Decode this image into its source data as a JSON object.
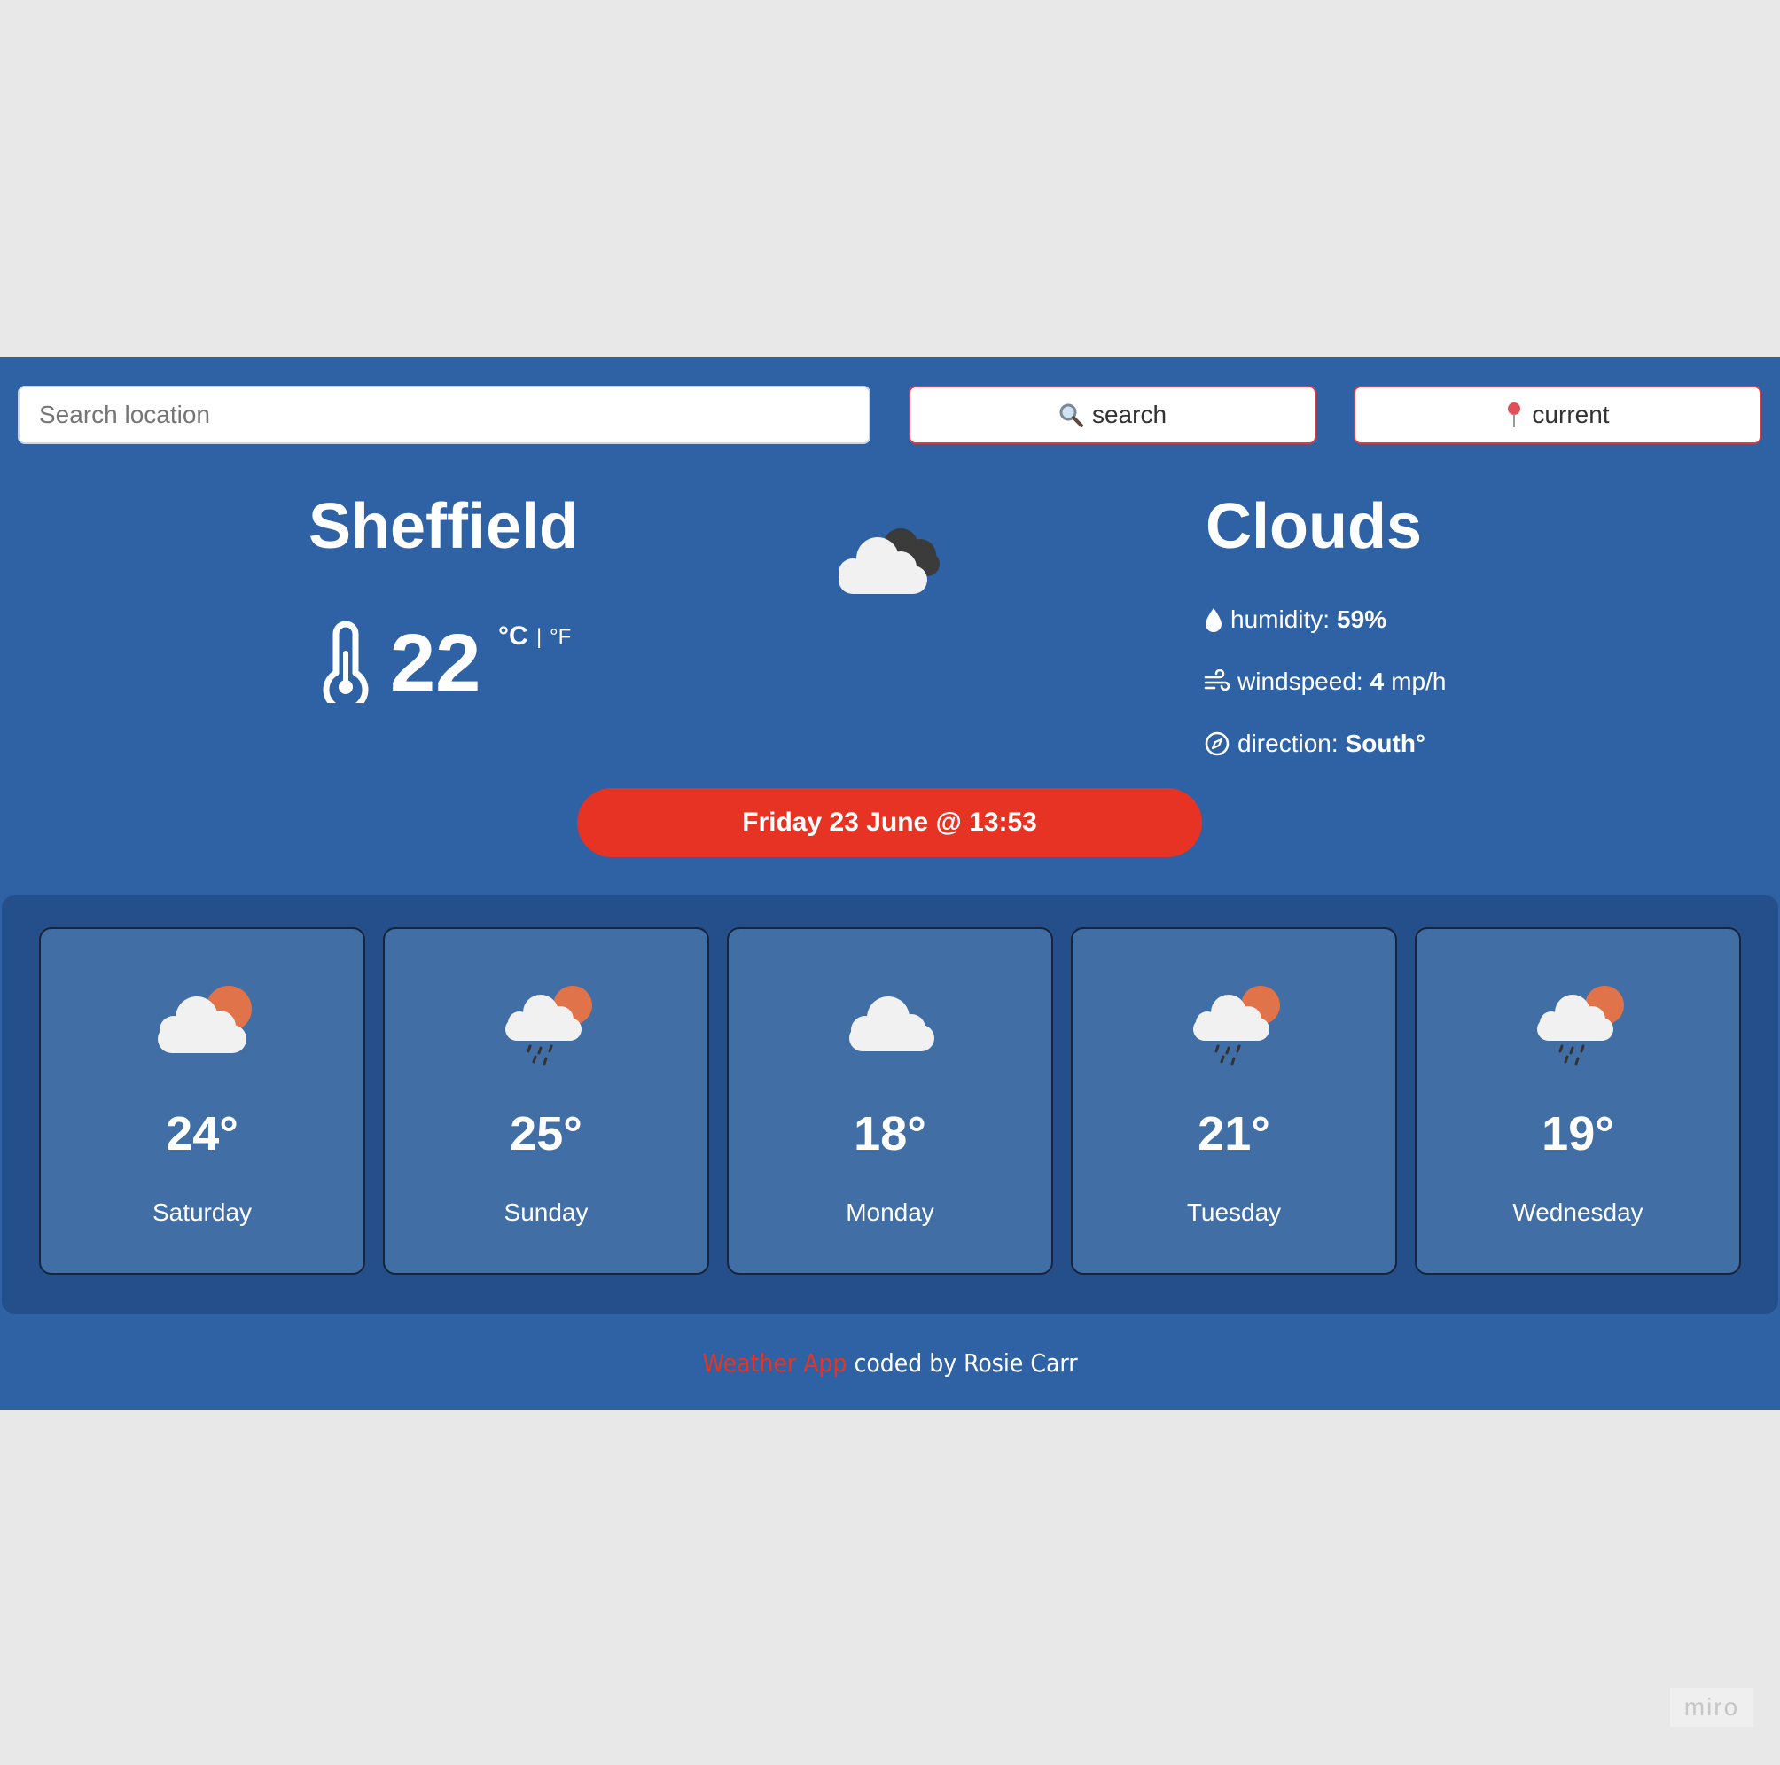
{
  "search": {
    "placeholder": "Search location",
    "value": "",
    "search_label": "search",
    "current_label": "current"
  },
  "current": {
    "city": "Sheffield",
    "temperature": "22",
    "unit_c": "°C",
    "unit_separator": "|",
    "unit_f": "°F",
    "condition": "Clouds",
    "icon": "broken-clouds-icon",
    "humidity_label": "humidity:",
    "humidity_value": "59%",
    "wind_label": "windspeed:",
    "wind_value": "4",
    "wind_unit": "mp/h",
    "direction_label": "direction:",
    "direction_value": "South°",
    "date": "Friday 23 June @ 13:53"
  },
  "forecast": [
    {
      "temp": "24°",
      "day": "Saturday",
      "icon": "partly-cloudy-icon"
    },
    {
      "temp": "25°",
      "day": "Sunday",
      "icon": "rain-sun-icon"
    },
    {
      "temp": "18°",
      "day": "Monday",
      "icon": "cloud-icon"
    },
    {
      "temp": "21°",
      "day": "Tuesday",
      "icon": "rain-sun-icon"
    },
    {
      "temp": "19°",
      "day": "Wednesday",
      "icon": "rain-sun-icon"
    }
  ],
  "footer": {
    "link": "Weather App",
    "text": " coded by Rosie Carr"
  },
  "watermark": "miro",
  "colors": {
    "page_bg": "#e8e8e8",
    "app_bg": "#2e62a5",
    "forecast_bg": "#254f8a",
    "card_bg": "#426ea6",
    "accent_red": "#e63323",
    "sun": "#e0734a"
  }
}
